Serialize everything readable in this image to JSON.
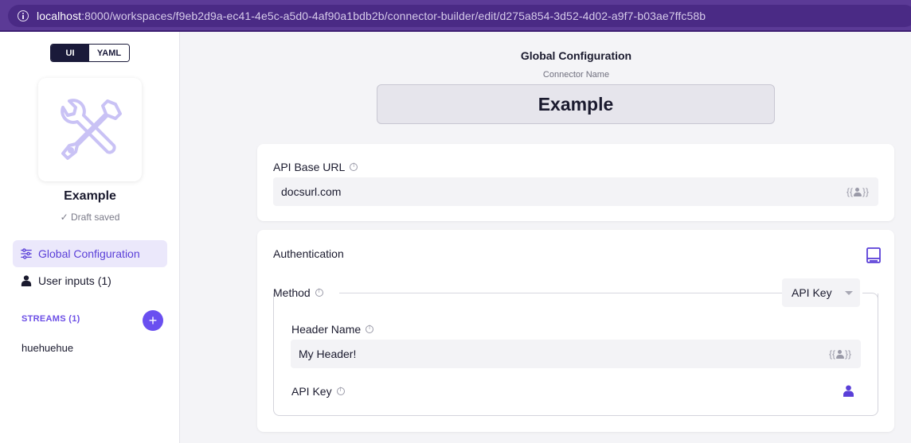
{
  "browser": {
    "url_host": "localhost",
    "url_rest": ":8000/workspaces/f9eb2d9a-ec41-4e5c-a5d0-4af90a1bdb2b/connector-builder/edit/d275a854-3d52-4d02-a9f7-b03ae7ffc58b"
  },
  "sidebar": {
    "view_toggle": {
      "ui_label": "UI",
      "yaml_label": "YAML",
      "active": "UI"
    },
    "connector_name": "Example",
    "save_status": "Draft saved",
    "nav": [
      {
        "label": "Global Configuration",
        "icon": "sliders-icon",
        "active": true
      },
      {
        "label": "User inputs (1)",
        "icon": "user-icon",
        "active": false
      }
    ],
    "streams_label": "STREAMS (1)",
    "add_stream_label": "+",
    "streams": [
      "huehuehue"
    ]
  },
  "main": {
    "title": "Global Configuration",
    "connector_name_label": "Connector Name",
    "connector_name_value": "Example",
    "api_base_url": {
      "label": "API Base URL",
      "value": "docsurl.com",
      "user_input_tag": "{{ }}"
    },
    "authentication": {
      "title": "Authentication",
      "method_label": "Method",
      "method_value": "API Key",
      "header_name": {
        "label": "Header Name",
        "value": "My Header!"
      },
      "api_key": {
        "label": "API Key"
      }
    }
  },
  "colors": {
    "accent": "#6a4ff0",
    "nav_active_bg": "#ebe8fb",
    "browser_bar": "#5b3a96"
  }
}
